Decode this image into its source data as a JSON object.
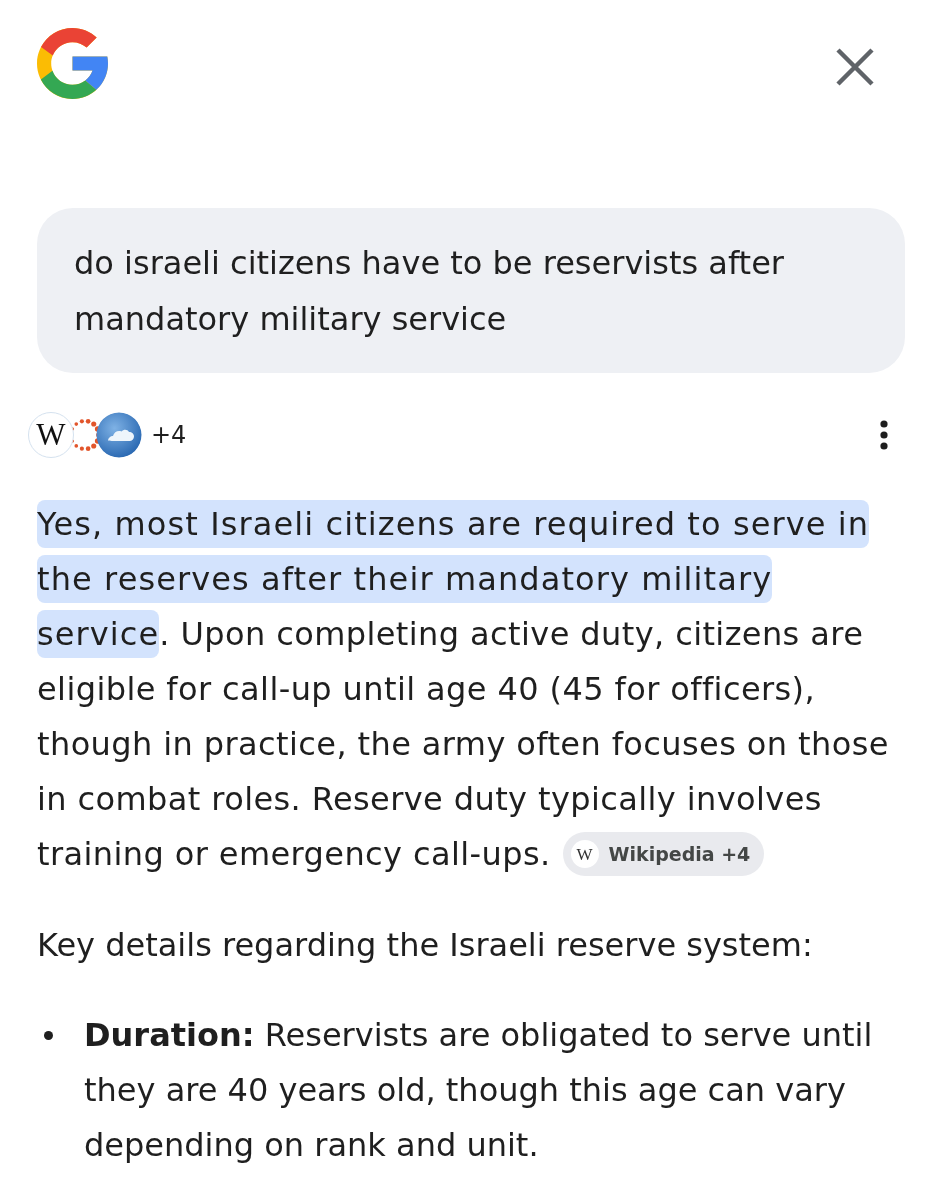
{
  "query": {
    "text": "do israeli citizens have to be reservists after mandatory military service"
  },
  "sources": {
    "icons": [
      {
        "kind": "letter",
        "glyph": "W"
      },
      {
        "kind": "dotted-ring"
      },
      {
        "kind": "cloud"
      }
    ],
    "more_count": "+4"
  },
  "answer": {
    "segments": [
      {
        "text": "Yes, most Israeli citizens are required to serve in the reserves after their mandatory military service",
        "highlighted": true
      },
      {
        "text": ". Upon completing active duty, citizens are eligible for call-up until age 40 (45 for officers), though in practice, the army often focuses on those in combat roles. Reserve duty typically involves training or emergency call-ups.",
        "highlighted": false
      }
    ],
    "citation": {
      "glyph": "W",
      "label": "Wikipedia +4"
    }
  },
  "details_intro": "Key details regarding the Israeli reserve system:",
  "details": [
    {
      "text": "**Duration:** Reservists are obligated to serve until they are 40 years old, though this age can vary depending on rank and unit."
    }
  ]
}
